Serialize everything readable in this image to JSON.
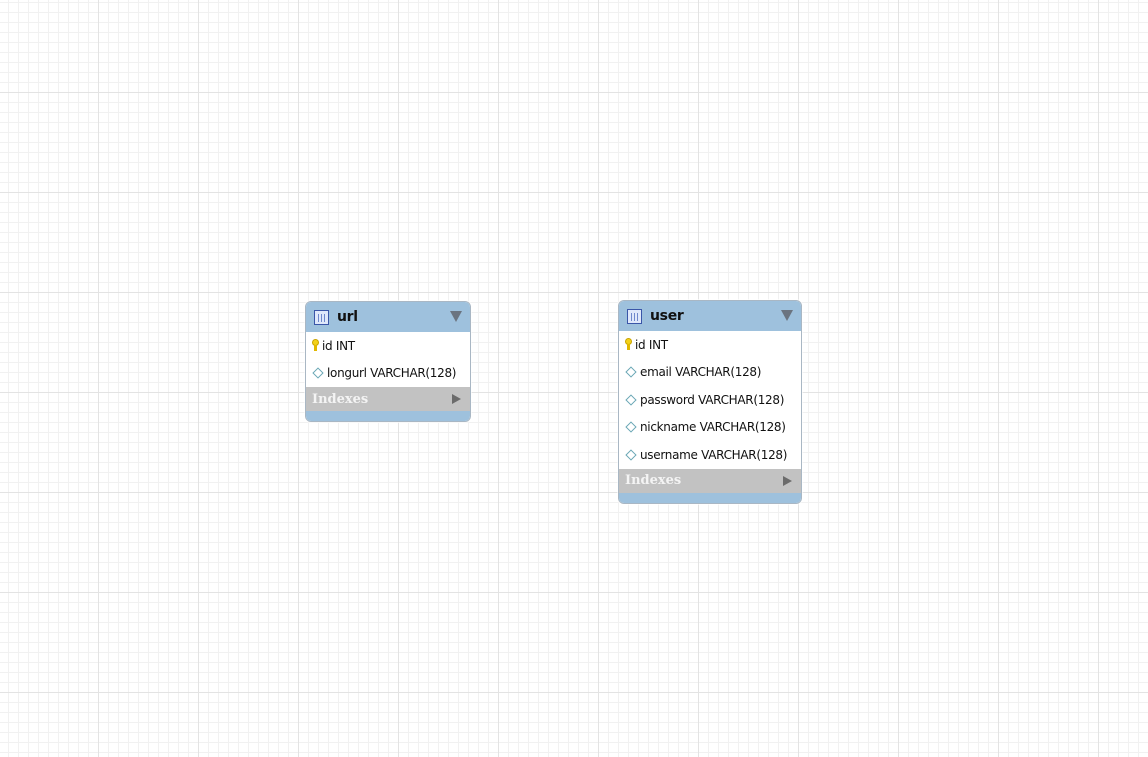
{
  "tables": [
    {
      "name": "url",
      "columns": [
        {
          "label": "id INT",
          "key": true
        },
        {
          "label": "longurl VARCHAR(128)",
          "key": false
        }
      ],
      "indexes_label": "Indexes"
    },
    {
      "name": "user",
      "columns": [
        {
          "label": "id INT",
          "key": true
        },
        {
          "label": "email VARCHAR(128)",
          "key": false
        },
        {
          "label": "password VARCHAR(128)",
          "key": false
        },
        {
          "label": "nickname VARCHAR(128)",
          "key": false
        },
        {
          "label": "username VARCHAR(128)",
          "key": false
        }
      ],
      "indexes_label": "Indexes"
    }
  ],
  "colors": {
    "header": "#9ec1dd",
    "indexes_bar": "#c2c2c2",
    "primary_key_icon": "#f3d21a",
    "column_diamond": "#6aa7b5"
  },
  "icons": {
    "table": "table-icon",
    "collapse": "collapse-triangle-icon",
    "primary_key": "primary-key-icon",
    "column": "column-diamond-icon",
    "expand_indexes": "expand-arrow-icon"
  }
}
